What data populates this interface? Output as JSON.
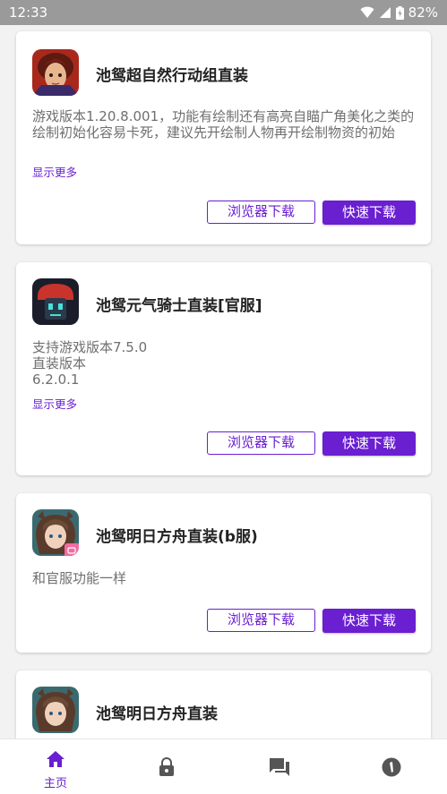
{
  "status_bar": {
    "time": "12:33",
    "battery": "82%",
    "icons": [
      "wifi-icon",
      "signal-icon",
      "battery-charging-icon"
    ]
  },
  "colors": {
    "accent": "#6a1fd1",
    "background": "#f2f2f2",
    "card": "#ffffff"
  },
  "cards": [
    {
      "title": "池鸳超自然行动组直装",
      "icon": "supernatural-game-icon",
      "desc_lines": [
        "游戏版本1.20.8.001，功能有绘制还有高亮自瞄广角美化之类的",
        "绘制初始化容易卡死，建议先开绘制人物再开绘制物资的初始"
      ],
      "more": "显示更多",
      "browser_download": "浏览器下载",
      "fast_download": "快速下载"
    },
    {
      "title": "池鸳元气骑士直装[官服]",
      "icon": "soul-knight-icon",
      "desc_lines": [
        "支持游戏版本7.5.0",
        "直装版本",
        "6.2.0.1"
      ],
      "more": "显示更多",
      "browser_download": "浏览器下载",
      "fast_download": "快速下载"
    },
    {
      "title": "池鸳明日方舟直装(b服)",
      "icon": "arknights-icon",
      "desc_lines": [
        "和官服功能一样"
      ],
      "browser_download": "浏览器下载",
      "fast_download": "快速下载"
    },
    {
      "title": "池鸳明日方舟直装",
      "icon": "arknights-icon"
    }
  ],
  "bottom_nav": {
    "items": [
      {
        "label": "主页",
        "icon": "home-icon",
        "active": true
      },
      {
        "label": "",
        "icon": "lock-icon",
        "active": false
      },
      {
        "label": "",
        "icon": "chat-icon",
        "active": false
      },
      {
        "label": "",
        "icon": "info-icon",
        "active": false
      }
    ]
  }
}
